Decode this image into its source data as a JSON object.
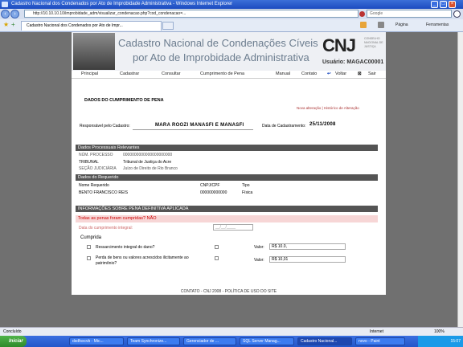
{
  "browser": {
    "title": "Cadastro Nacional dos Condenados por Ato de Improbidade Administrativa - Windows Internet Explorer",
    "url": "http://10.10.10.10/improbidade_adm/visualizar_condenacao.php?cod_condenacao=...",
    "search_placeholder": "Google",
    "tab_label": "Cadastro Nacional dos Condenados por Ato de Impr...",
    "cmd": {
      "pagina": "Página",
      "ferramentas": "Ferramentas"
    },
    "status_left": "Concluído",
    "status_right": "Internet",
    "zoom": "100%"
  },
  "header": {
    "title_line1": "Cadastro Nacional de Condenações Cíveis",
    "title_line2": "por Ato de Improbidade Administrativa",
    "logo": "CNJ",
    "logo_sub": "CONSELHO NACIONAL DE JUSTIÇA",
    "usuario": "Usuário: MAGAC00001"
  },
  "menu": {
    "principal": "Principal",
    "cadastrar": "Cadastrar",
    "consultar": "Consultar",
    "cumprimento": "Cumprimento de Pena",
    "manual": "Manual",
    "contato": "Contato",
    "voltar": "Voltar",
    "sair": "Sair"
  },
  "section": {
    "title": "DADOS DO CUMPRIMENTO DE PENA",
    "links": "Nova alteração | Histórico de Alteração"
  },
  "cadastro": {
    "responsavel_label": "Responsável pelo Cadastro:",
    "responsavel_value": "MARA ROOZI MANASFI E MANASFI",
    "data_label": "Data de Cadastramento:",
    "data_value": "25/11/2008"
  },
  "processo": {
    "header": "Dados Processuais Relevantes",
    "num_label": "NÚM. PROCESSO",
    "num_value": "0000000000000000000000",
    "tribunal_label": "TRIBUNAL",
    "tribunal_value": "Tribunal de Justiça do Acre",
    "secao_label": "SEÇÃO JUDICIÁRIA",
    "secao_value": "Juízo de Direito de Rio Branco"
  },
  "requerido": {
    "header": "Dados do Requerido",
    "col_nome": "Nome Requerido",
    "col_cnpj": "CNPJ/CPF",
    "col_tipo": "Tipo",
    "nome": "BENTO FRANCISCO REIS",
    "cnpj": "000000000000",
    "tipo": "Física"
  },
  "pena": {
    "header": "INFORMAÇÕES SOBRE PENA DEFINITIVA APLICADA",
    "cumpridas_question": "Todas as penas foram cumpridas? NÃO",
    "data_label": "Data do cumprimento integral:",
    "data_placeholder": "__/__/____",
    "cumprida_title": "Cumprida",
    "item1_label": "Ressarcimento integral do dano?",
    "item2_label": "Perda de bens ou valores acrescidos ilicitamente ao patrimônio?",
    "valor_label": "Valor:",
    "valor_value": "R$ 10.0,",
    "valor2_value": "R$ 10,01"
  },
  "footer": "CONTATO - CNJ 2008 - POLÍTICA DE USO DO SITE",
  "taskbar": {
    "start": "Iniciar",
    "tasks": [
      "dsdfsxcvb - Mic...",
      "Team Synchronize...",
      "Gerenciador de ...",
      "SQL Server Manag...",
      "Cadastro Nacional...",
      "novo - Paint"
    ],
    "clock": "15:07"
  }
}
